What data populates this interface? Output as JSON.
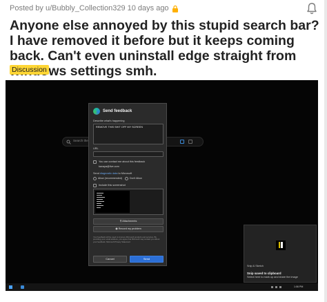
{
  "post": {
    "meta": "Posted by u/Bubbly_Collection329 10 days ago",
    "title": "Anyone else annoyed by this stupid search bar? I have removed it before but it keeps coming back. Can't even uninstall edge straight from windows settings smh.",
    "flair": "Discussion",
    "flair_color": "#ffd635"
  },
  "icons": {
    "lock": "lock-icon",
    "notification": "bell-icon",
    "search": "search-icon"
  },
  "screenshot": {
    "searchbar_placeholder": "Search the w",
    "dialog": {
      "title": "Send feedback",
      "describe_label": "Describe what's happening",
      "describe_value": "REMOVE THIS SHIT OFF MY SCREEN",
      "url_label": "URL",
      "contact_label": "You can contact me about this feedback",
      "contact_email": "kavaya@live.com",
      "diagnostic_prefix": "Send",
      "diagnostic_link": "diagnostic data",
      "diagnostic_suffix": "to Microsoft",
      "allow_option": "Allow (recommended)",
      "dont_allow_option": "Don't Allow",
      "include_screenshot_label": "Include this screenshot",
      "attachments_button": "Attachments",
      "record_button": "Record my problem",
      "fine_print": "Your feedback will be used to improve Microsoft products and services. By providing your email address, you agree that Microsoft may contact you about your feedback. Microsoft Privacy Statement",
      "cancel_button": "Cancel",
      "send_button": "Send",
      "accent_color": "#2c6fd6"
    },
    "toast": {
      "app": "Snip & Sketch",
      "title": "Snip saved to clipboard",
      "body": "Select here to mark up and share the image"
    },
    "taskbar": {
      "clock": "1:06 PM"
    }
  }
}
